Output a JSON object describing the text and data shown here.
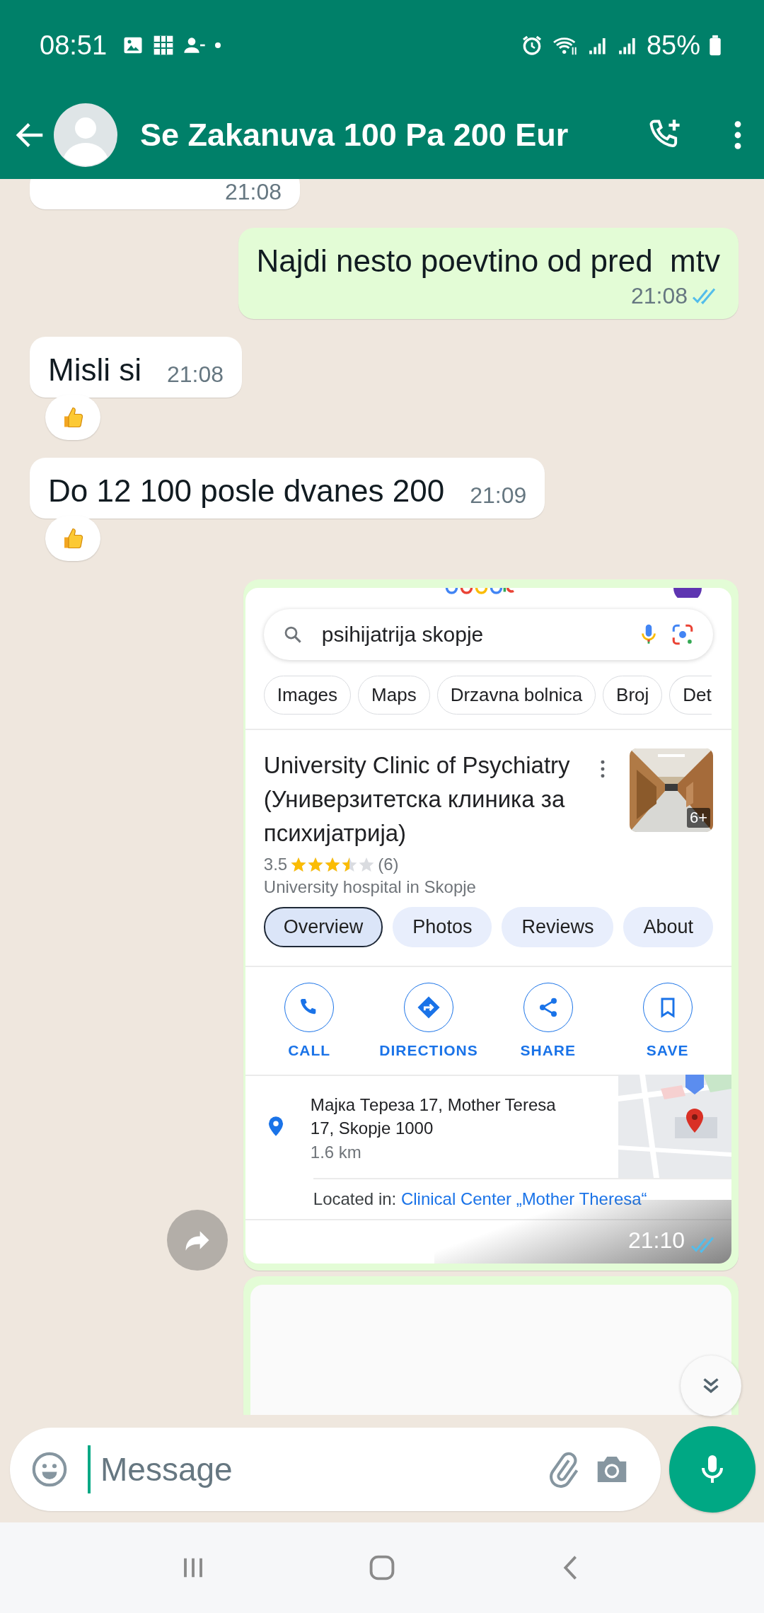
{
  "status_bar": {
    "time": "08:51",
    "battery": "85%"
  },
  "header": {
    "title": "Se Zakanuva 100 Pa 200 Eur"
  },
  "messages": [
    {
      "kind": "incoming",
      "time": "21:08",
      "reacted": false
    },
    {
      "kind": "outgoing",
      "text": "Najdi nesto poevtino od pred  mtv",
      "time": "21:08",
      "read": true
    },
    {
      "kind": "incoming",
      "text": "Misli si",
      "time": "21:08",
      "reacted": true
    },
    {
      "kind": "incoming",
      "text": "Do 12 100 posle dvanes 200",
      "time": "21:09",
      "reacted": true
    },
    {
      "kind": "screenshot",
      "time": "21:10",
      "read": true
    },
    {
      "kind": "blank"
    }
  ],
  "screenshot": {
    "query": "psihijatrija skopje",
    "chips": [
      "Images",
      "Maps",
      "Drzavna bolnica",
      "Broj",
      "Det"
    ],
    "place": {
      "name": "University Clinic of Psychiatry (Универзитетска клиника за психијатрија)",
      "rating": "3.5",
      "stars": 3.5,
      "reviews": "(6)",
      "category": "University hospital in Skopje",
      "photo_count": "6+"
    },
    "tabs": [
      {
        "label": "Overview",
        "selected": true
      },
      {
        "label": "Photos",
        "selected": false
      },
      {
        "label": "Reviews",
        "selected": false
      },
      {
        "label": "About",
        "selected": false
      }
    ],
    "actions": [
      {
        "kind": "call",
        "label": "CALL"
      },
      {
        "kind": "directions",
        "label": "DIRECTIONS"
      },
      {
        "kind": "share",
        "label": "SHARE"
      },
      {
        "kind": "save",
        "label": "SAVE"
      }
    ],
    "address": "Мајка Тереза 17, Mother Teresa 17, Skopje 1000",
    "distance": "1.6 km",
    "located_label": "Located in:",
    "located_link": "Clinical Center „Mother Theresa“"
  },
  "composer": {
    "placeholder": "Message"
  }
}
